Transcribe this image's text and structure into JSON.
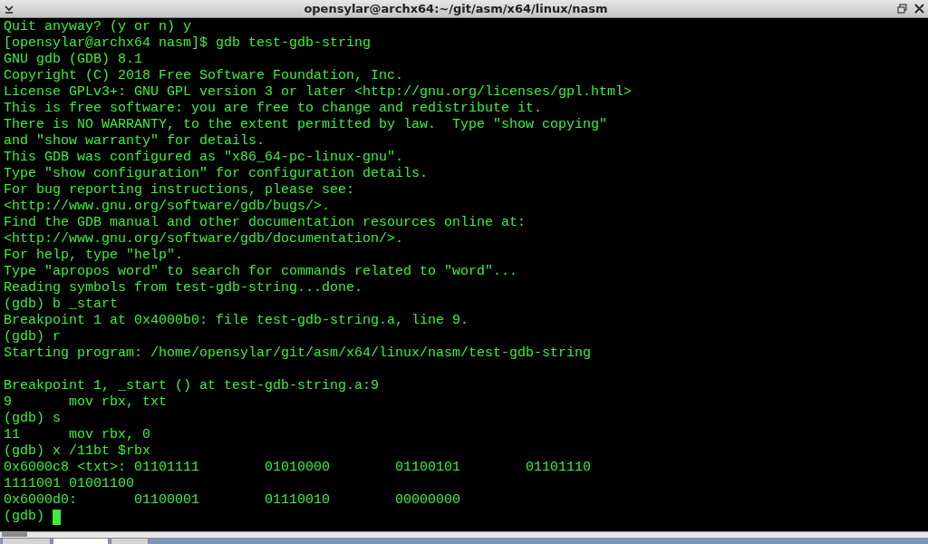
{
  "window": {
    "title": "opensylar@archx64:~/git/asm/x64/linux/nasm"
  },
  "terminal": {
    "lines": [
      {
        "text": "Quit anyway? (y or n) y"
      },
      {
        "text": "[opensylar@archx64 nasm]$ gdb test-gdb-string"
      },
      {
        "text": "GNU gdb (GDB) 8.1"
      },
      {
        "text": "Copyright (C) 2018 Free Software Foundation, Inc."
      },
      {
        "text": "License GPLv3+: GNU GPL version 3 or later <http://gnu.org/licenses/gpl.html>"
      },
      {
        "text": "This is free software: you are free to change and redistribute it."
      },
      {
        "text": "There is NO WARRANTY, to the extent permitted by law.  Type \"show copying\""
      },
      {
        "text": "and \"show warranty\" for details."
      },
      {
        "text": "This GDB was configured as \"x86_64-pc-linux-gnu\"."
      },
      {
        "text": "Type \"show configuration\" for configuration details."
      },
      {
        "text": "For bug reporting instructions, please see:"
      },
      {
        "text": "<http://www.gnu.org/software/gdb/bugs/>."
      },
      {
        "text": "Find the GDB manual and other documentation resources online at:"
      },
      {
        "text": "<http://www.gnu.org/software/gdb/documentation/>."
      },
      {
        "text": "For help, type \"help\"."
      },
      {
        "text": "Type \"apropos word\" to search for commands related to \"word\"..."
      },
      {
        "text": "Reading symbols from test-gdb-string...done."
      },
      {
        "text": "(gdb) b _start"
      },
      {
        "text": "Breakpoint 1 at 0x4000b0: file test-gdb-string.a, line 9."
      },
      {
        "text": "(gdb) r"
      },
      {
        "text": "Starting program: /home/opensylar/git/asm/x64/linux/nasm/test-gdb-string"
      },
      {
        "text": "Breakpoint 1, _start () at test-gdb-string.a:9",
        "gap_before": true
      },
      {
        "text": "9       mov rbx, txt"
      },
      {
        "text": "(gdb) s"
      },
      {
        "text": "11      mov rbx, 0"
      },
      {
        "text": "(gdb) x /11bt $rbx"
      },
      {
        "text": "0x6000c8 <txt>: 01101111        01010000        01100101        01101110"
      },
      {
        "text": "1111001 01001100"
      },
      {
        "text": "0x6000d0:       01100001        01110010        00000000"
      },
      {
        "text": "(gdb) ",
        "cursor": true
      }
    ]
  }
}
